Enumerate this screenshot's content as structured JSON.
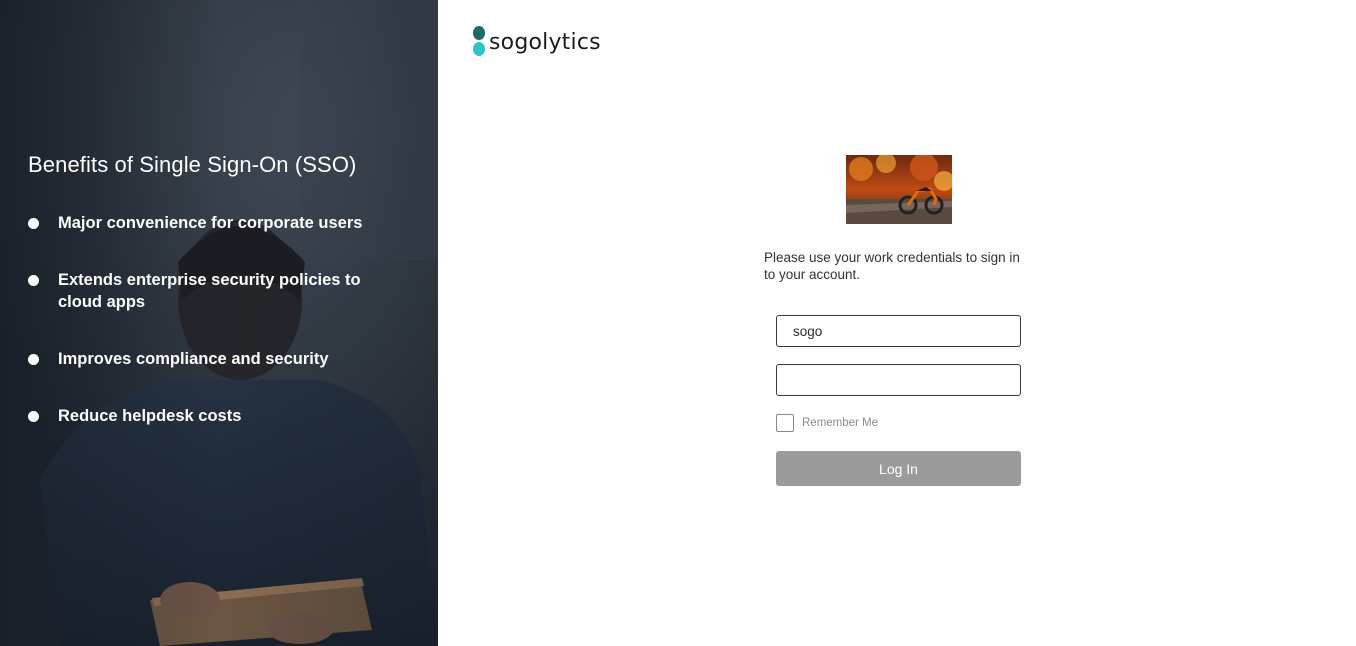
{
  "hero": {
    "title": "Benefits of Single Sign-On (SSO)",
    "benefits": [
      "Major convenience for corporate users",
      "Extends enterprise security policies to cloud apps",
      "Improves compliance and security",
      "Reduce helpdesk costs"
    ]
  },
  "logo": {
    "text": "sogolytics"
  },
  "login": {
    "instructions": "Please use your work credentials to sign in to your account.",
    "username_value": "sogo",
    "password_value": "",
    "remember_label": "Remember Me",
    "login_label": "Log In"
  },
  "colors": {
    "logo_dark": "#1a6b6b",
    "logo_light": "#2ec4c7",
    "button_disabled": "#9b9b9b"
  }
}
